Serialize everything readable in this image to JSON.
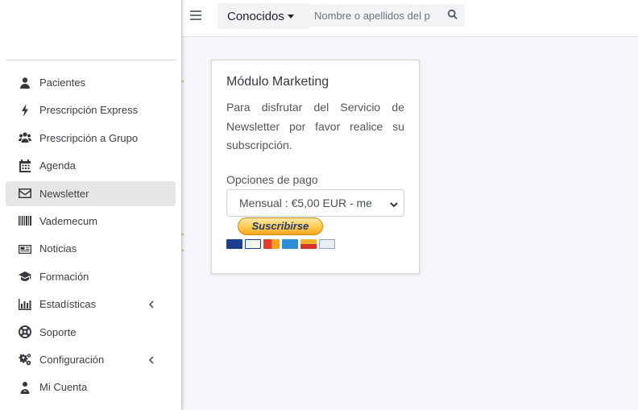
{
  "sidebar": {
    "items": [
      {
        "label": "Pacientes",
        "icon": "user-icon"
      },
      {
        "label": "Prescripción Express",
        "icon": "bolt-icon"
      },
      {
        "label": "Prescripción a Grupo",
        "icon": "users-icon"
      },
      {
        "label": "Agenda",
        "icon": "calendar-icon"
      },
      {
        "label": "Newsletter",
        "icon": "envelope-icon",
        "active": true
      },
      {
        "label": "Vademecum",
        "icon": "barcode-icon"
      },
      {
        "label": "Noticias",
        "icon": "newspaper-icon"
      },
      {
        "label": "Formación",
        "icon": "graduation-cap-icon"
      },
      {
        "label": "Estadísticas",
        "icon": "bar-chart-icon",
        "chevron": true
      },
      {
        "label": "Soporte",
        "icon": "life-ring-icon"
      },
      {
        "label": "Configuración",
        "icon": "cogs-icon",
        "chevron": true
      },
      {
        "label": "Mi Cuenta",
        "icon": "user-doctor-icon"
      }
    ]
  },
  "topbar": {
    "filter_label": "Conocidos",
    "search_placeholder": "Nombre o apellidos del p"
  },
  "card": {
    "title": "Módulo Marketing",
    "text": "Para disfrutar del Servicio de Newsletter por favor realice su subscripción.",
    "payment_label": "Opciones de pago",
    "payment_selected": "Mensual : €5,00 EUR - me",
    "subscribe_label": "Suscribirse"
  },
  "colors": {
    "sidebar_active": "#e6e6e6",
    "paypal_gold": "#ffc94d",
    "paypal_text": "#1f3b73"
  }
}
